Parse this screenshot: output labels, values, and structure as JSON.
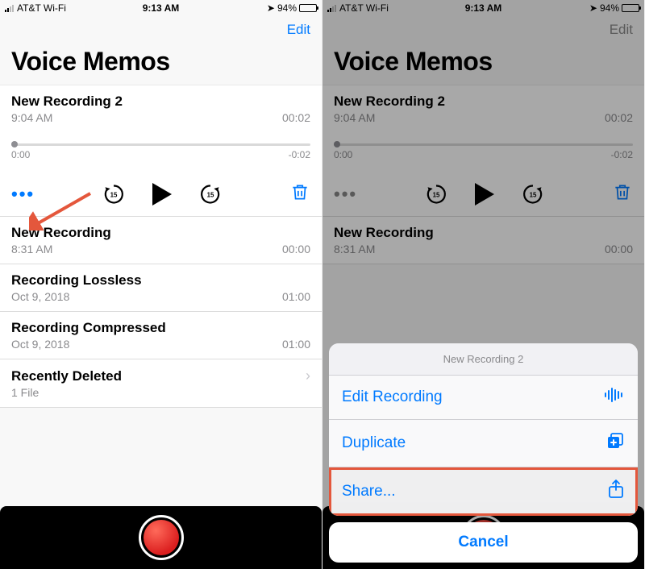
{
  "status": {
    "carrier": "AT&T Wi-Fi",
    "time": "9:13 AM",
    "location_icon": "location",
    "battery_pct": "94%"
  },
  "nav": {
    "edit": "Edit",
    "title": "Voice Memos"
  },
  "expanded": {
    "title": "New Recording 2",
    "subtitle": "9:04 AM",
    "duration": "00:02",
    "scrub_start": "0:00",
    "scrub_end": "-0:02",
    "skip_seconds": "15"
  },
  "recordings": [
    {
      "title": "New Recording",
      "subtitle": "8:31 AM",
      "duration": "00:00"
    },
    {
      "title": "Recording Lossless",
      "subtitle": "Oct 9, 2018",
      "duration": "01:00"
    },
    {
      "title": "Recording Compressed",
      "subtitle": "Oct 9, 2018",
      "duration": "01:00"
    }
  ],
  "recently_deleted": {
    "title": "Recently Deleted",
    "subtitle": "1 File"
  },
  "sheet": {
    "header": "New Recording 2",
    "edit": "Edit Recording",
    "duplicate": "Duplicate",
    "share": "Share...",
    "cancel": "Cancel"
  },
  "colors": {
    "accent": "#007aff",
    "record": "#db1f1f",
    "annotation": "#e4573c"
  }
}
